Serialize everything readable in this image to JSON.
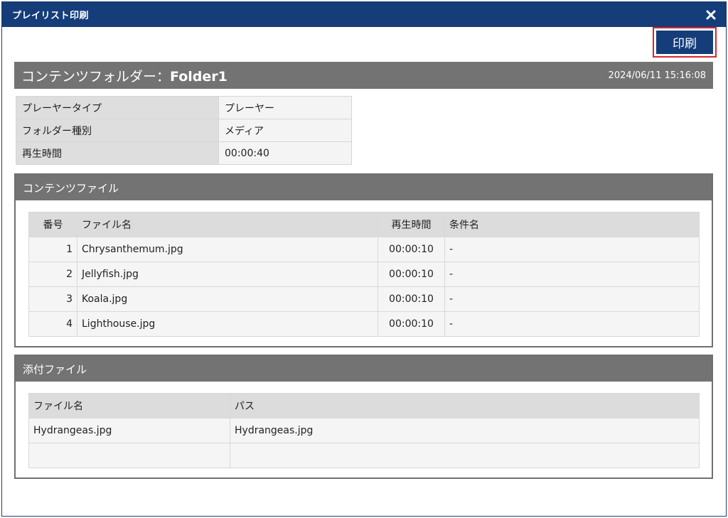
{
  "window": {
    "title": "プレイリスト印刷",
    "close_icon": "close-icon"
  },
  "toolbar": {
    "print_label": "印刷"
  },
  "header": {
    "title_prefix": "コンテンツフォルダー：",
    "folder_name": "Folder1",
    "datetime": "2024/06/11 15:16:08"
  },
  "info": [
    {
      "label": "プレーヤータイプ",
      "value": "プレーヤー"
    },
    {
      "label": "フォルダー種別",
      "value": "メディア"
    },
    {
      "label": "再生時間",
      "value": "00:00:40"
    }
  ],
  "contents": {
    "title": "コンテンツファイル",
    "headers": {
      "no": "番号",
      "filename": "ファイル名",
      "duration": "再生時間",
      "condition": "条件名"
    },
    "rows": [
      {
        "no": "1",
        "filename": "Chrysanthemum.jpg",
        "duration": "00:00:10",
        "condition": "-"
      },
      {
        "no": "2",
        "filename": "Jellyfish.jpg",
        "duration": "00:00:10",
        "condition": "-"
      },
      {
        "no": "3",
        "filename": "Koala.jpg",
        "duration": "00:00:10",
        "condition": "-"
      },
      {
        "no": "4",
        "filename": "Lighthouse.jpg",
        "duration": "00:00:10",
        "condition": "-"
      }
    ]
  },
  "attachments": {
    "title": "添付ファイル",
    "headers": {
      "filename": "ファイル名",
      "path": "パス"
    },
    "rows": [
      {
        "filename": "Hydrangeas.jpg",
        "path": "Hydrangeas.jpg"
      },
      {
        "filename": "",
        "path": ""
      }
    ]
  },
  "colors": {
    "titlebar": "#143d7a",
    "section_header": "#737373",
    "print_highlight": "#d9262c"
  }
}
